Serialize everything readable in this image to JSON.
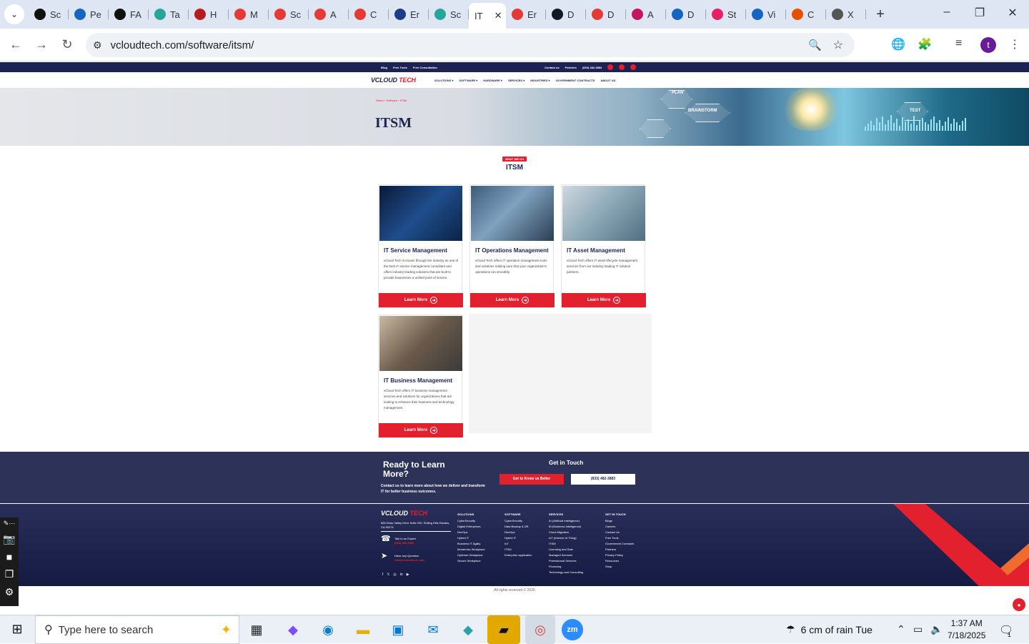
{
  "browser": {
    "tabs": [
      {
        "label": "Sc",
        "icon": "target-icon",
        "color": "#111111"
      },
      {
        "label": "Pe",
        "icon": "gauge-icon",
        "color": "#1565c0"
      },
      {
        "label": "FA",
        "icon": "openai-icon",
        "color": "#111111"
      },
      {
        "label": "Ta",
        "icon": "circle-icon",
        "color": "#26a69a"
      },
      {
        "label": "H",
        "icon": "v-logo-icon",
        "color": "#b71c1c"
      },
      {
        "label": "M",
        "icon": "diamond-icon",
        "color": "#e53935"
      },
      {
        "label": "Sc",
        "icon": "diamond-icon",
        "color": "#e53935"
      },
      {
        "label": "A",
        "icon": "diamond-icon",
        "color": "#e53935"
      },
      {
        "label": "C",
        "icon": "diamond-icon",
        "color": "#e53935"
      },
      {
        "label": "Er",
        "icon": "check-icon",
        "color": "#1e3a8a"
      },
      {
        "label": "Sc",
        "icon": "circle-icon",
        "color": "#26a69a"
      },
      {
        "label": "IT",
        "icon": "",
        "color": "#ffffff",
        "active": true
      },
      {
        "label": "Er",
        "icon": "diamond-icon",
        "color": "#e53935"
      },
      {
        "label": "D",
        "icon": "x-logo-icon",
        "color": "#111827"
      },
      {
        "label": "D",
        "icon": "diamond-icon",
        "color": "#e53935"
      },
      {
        "label": "A",
        "icon": "leaf-icon",
        "color": "#c2185b"
      },
      {
        "label": "D",
        "icon": "scale-icon",
        "color": "#1565c0"
      },
      {
        "label": "St",
        "icon": "bolt-icon",
        "color": "#e91e63"
      },
      {
        "label": "Vi",
        "icon": "pulse-icon",
        "color": "#1565c0"
      },
      {
        "label": "C",
        "icon": "slash-icon",
        "color": "#e65100"
      },
      {
        "label": "X",
        "icon": "globe-icon",
        "color": "#555555"
      }
    ],
    "new_tab": "+",
    "url": "vcloudtech.com/software/itsm/"
  },
  "site": {
    "topbar": {
      "left": [
        "Blog",
        "Free Tools",
        "Free Consultation"
      ],
      "right": [
        "Contact us",
        "Partners",
        "(833) 482-3883"
      ]
    },
    "logo": {
      "a": "VCLOUD",
      "b": "TECH"
    },
    "nav": [
      "SOLUTIONS ▾",
      "SOFTWARE ▾",
      "HARDWARE ▾",
      "SERVICES ▾",
      "INDUSTRIES ▾",
      "GOVERNMENT CONTRACTS",
      "ABOUT US"
    ],
    "hero": {
      "crumb": "Home › Software › ITSM",
      "title": "ITSM",
      "labels": [
        "PLAN",
        "BRAINSTORM",
        "TEST"
      ]
    },
    "section": {
      "badge": "WHAT WE DO",
      "title": "ITSM"
    },
    "cards": [
      {
        "title": "IT Service Management",
        "text": "vCloud Tech is known through the industry as one of the best IT service management consultant and offers industry leading solutions that are built to provide businesses a unified point of service.",
        "button": "Learn More"
      },
      {
        "title": "IT Operations Management",
        "text": "vCloud Tech offers IT operation management tools and solutions making sure that your organization's operations run smoothly.",
        "button": "Learn More"
      },
      {
        "title": "IT Asset Management",
        "text": "vCloud Tech offers IT asset lifecycle management services from our industry leading IT solution partners.",
        "button": "Learn More"
      },
      {
        "title": "IT Business Management",
        "text": "vCloud Tech offers IT business management services and solutions for organizations that are looking to enhance their business and technology management.",
        "button": "Learn More"
      }
    ],
    "cta": {
      "title": "Ready to Learn More?",
      "text": "Contact us to learn more about how we deliver and transform IT for better business outcomes.",
      "get_in_touch": "Get in Touch",
      "btn1": "Get to Know us Better",
      "btn2": "(833) 482-3883"
    },
    "footer": {
      "address": "666 Deep Valley Drive Suite 200, Rolling Hills Estates, CA 90274",
      "talk_label": "Talk to an Expert",
      "talk_value": "(833) 482-3883",
      "question_label": "Have any Question",
      "question_value": "info@vcloudtech.com",
      "columns": [
        {
          "heading": "SOLUTIONS",
          "items": [
            "CyberSecurity",
            "Digital Enterprises",
            "DevOps",
            "Hybrid IT",
            "Business IT Agility",
            "Modernize Workplace",
            "Optimize Workplace",
            "Secure Workplace"
          ]
        },
        {
          "heading": "SOFTWARE",
          "items": [
            "CyberSecurity",
            "Data Backup & DR",
            "DevOps",
            "Hybrid IT",
            "IoT",
            "ITSM",
            "Enterprise application"
          ]
        },
        {
          "heading": "SERVICES",
          "items": [
            "AI (Artificial Intelligence)",
            "BI (Business Intelligence)",
            "Cloud Migration",
            "IoT (Internet of Thing)",
            "ITSM",
            "Licensing and Sale",
            "Managed Services",
            "Professional Services",
            "Financing",
            "Technology and Consulting"
          ]
        },
        {
          "heading": "GET IN TOUCH",
          "items": [
            "Blogs",
            "Careers",
            "Contact Us",
            "Free Tools",
            "Government Contracts",
            "Partners",
            "Privacy Policy",
            "Resources",
            "Shop"
          ]
        }
      ],
      "copyright": "All rights reserved © 2025"
    }
  },
  "taskbar": {
    "search_placeholder": "Type here to search",
    "weather": "6 cm of rain Tue",
    "time": "1:37 AM",
    "date": "7/18/2025",
    "notifications": "1"
  }
}
